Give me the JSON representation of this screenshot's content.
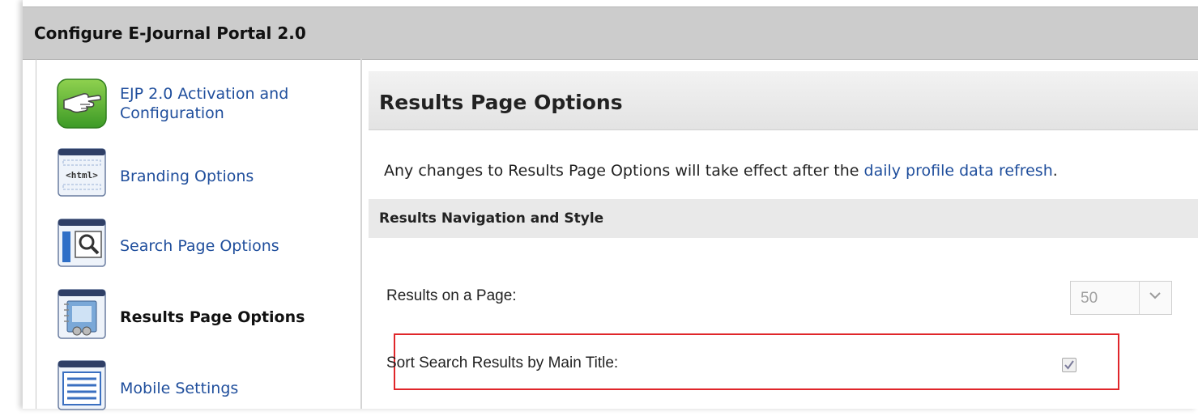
{
  "window": {
    "title": "Configure E-Journal Portal 2.0"
  },
  "sidebar": {
    "items": [
      {
        "label": "EJP 2.0 Activation and Configuration",
        "line1": "EJP 2.0 Activation and",
        "line2": "Configuration",
        "icon": "pointing-hand-icon",
        "active": false
      },
      {
        "label": "Branding Options",
        "icon": "html-window-icon",
        "active": false
      },
      {
        "label": "Search Page Options",
        "icon": "search-window-icon",
        "active": false
      },
      {
        "label": "Results Page Options",
        "icon": "results-notebook-icon",
        "active": true
      },
      {
        "label": "Mobile Settings",
        "icon": "mobile-list-icon",
        "active": false
      }
    ]
  },
  "main": {
    "section_title": "Results Page Options",
    "notice_prefix": "Any changes to Results Page Options will take effect after the ",
    "notice_link": "daily profile data refresh",
    "notice_suffix": ".",
    "subsection_title": "Results Navigation and Style",
    "options": {
      "results_per_page_label": "Results on a Page:",
      "results_per_page_value": "50",
      "sort_by_title_label": "Sort Search Results by Main Title:",
      "sort_by_title_checked": true
    }
  },
  "colors": {
    "link": "#1f4e9c",
    "highlight_border": "#e0262a",
    "title_bar": "#cccccc"
  }
}
